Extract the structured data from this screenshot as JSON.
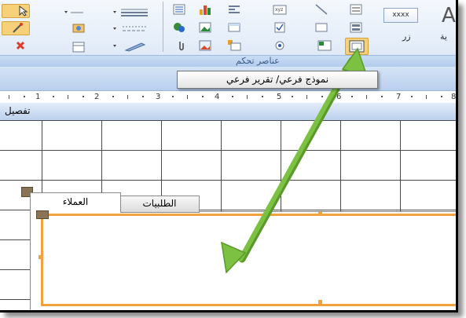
{
  "ribbon": {
    "group_label": "عناصر تحكم",
    "xxxx_button_label": "xxxx",
    "button_label": "زر",
    "partial_label": "ية"
  },
  "tooltip": {
    "text": "نموذج فرعي/ تقرير فرعي"
  },
  "ruler": {
    "numbers": [
      "1",
      "2",
      "3",
      "4",
      "5",
      "6",
      "7",
      "8"
    ]
  },
  "section": {
    "header": "تفصيل"
  },
  "tabs": {
    "customers": "العملاء",
    "orders": "الطلبيات"
  },
  "colors": {
    "arrow": "#7cc142",
    "selection": "#f3a13a",
    "ribbon_bg": "#dbe7f6"
  }
}
